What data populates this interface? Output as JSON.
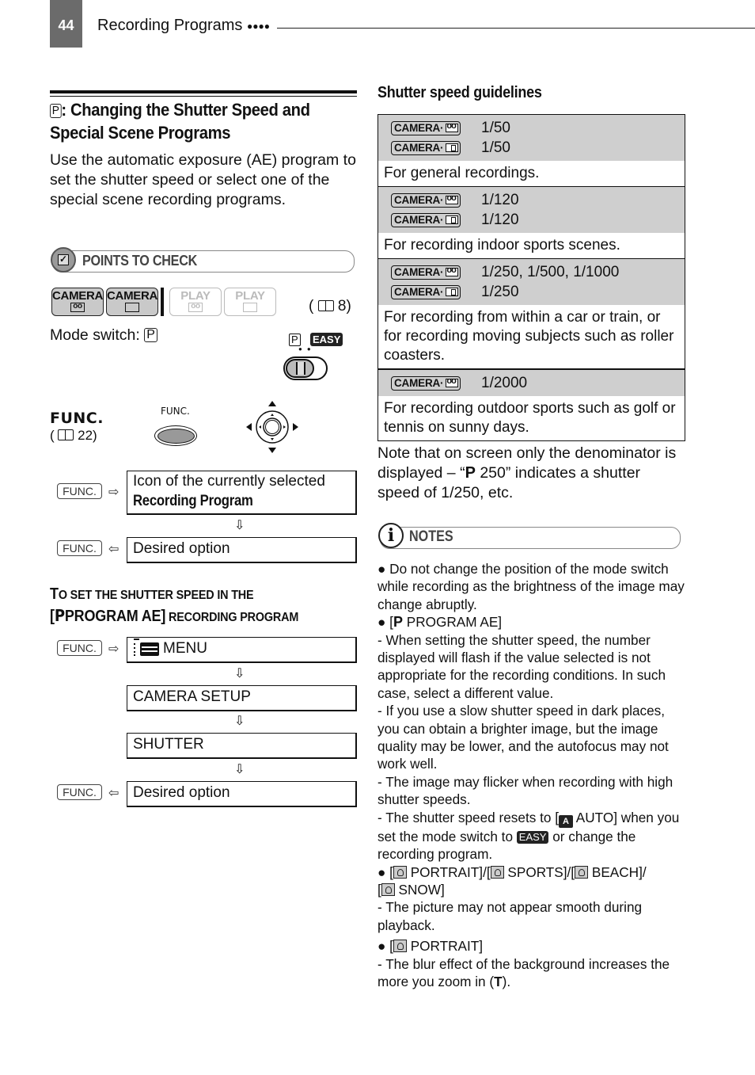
{
  "header": {
    "page_number": "44",
    "running_title": "Recording Programs",
    "dots": "●●●●"
  },
  "left": {
    "title_icon": "P",
    "title_line1": ": Changing the Shutter Speed and",
    "title_line2": "Special Scene Programs",
    "intro": "Use the automatic exposure (AE) program to set the shutter speed or select one of the special scene recording programs.",
    "points_to_check": "POINTS TO CHECK",
    "mode_buttons": [
      {
        "label": "CAMERA",
        "icon": "tape-icon",
        "active": true
      },
      {
        "label": "CAMERA",
        "icon": "card-icon",
        "active": true
      },
      {
        "label": "PLAY",
        "icon": "tape-icon",
        "active": false
      },
      {
        "label": "PLAY",
        "icon": "card-icon",
        "active": false
      }
    ],
    "mode_ref": "8)",
    "mode_ref_open": "(",
    "mode_switch_label": "Mode switch:",
    "mode_switch_value": "P",
    "switch_p": "P",
    "switch_easy": "EASY",
    "func_label": "FUNC.",
    "func_ref": "22)",
    "func_ref_open": "(",
    "func_button_caption": "FUNC.",
    "flow1": {
      "func_key": "FUNC.",
      "step1_line1": "Icon of the currently selected",
      "step1_line2": "Recording Program",
      "step2": "Desired option"
    },
    "subheading": {
      "line1_big": "T",
      "line1_rest": "O SET THE SHUTTER SPEED IN THE",
      "line2_bracket": "[",
      "line2_p": "P",
      "line2_prog": "PROGRAM AE]",
      "line2_rest": " RECORDING PROGRAM"
    },
    "flow2": {
      "func_key": "FUNC.",
      "steps": [
        "MENU",
        "CAMERA SETUP",
        "SHUTTER",
        "Desired option"
      ]
    }
  },
  "right": {
    "heading": "Shutter speed guidelines",
    "rows": [
      {
        "speeds": [
          {
            "badge": "CAMERA·",
            "icon": "tape",
            "value": "1/50"
          },
          {
            "badge": "CAMERA·",
            "icon": "card",
            "value": "1/50"
          }
        ],
        "description": "For general recordings."
      },
      {
        "speeds": [
          {
            "badge": "CAMERA·",
            "icon": "tape",
            "value": "1/120"
          },
          {
            "badge": "CAMERA·",
            "icon": "card",
            "value": "1/120"
          }
        ],
        "description": "For recording indoor sports scenes."
      },
      {
        "speeds": [
          {
            "badge": "CAMERA·",
            "icon": "tape",
            "value": "1/250, 1/500, 1/1000"
          },
          {
            "badge": "CAMERA·",
            "icon": "card",
            "value": "1/250"
          }
        ],
        "description": "For recording from within a car or train, or for recording moving subjects such as roller coasters."
      },
      {
        "speeds": [
          {
            "badge": "CAMERA·",
            "icon": "tape",
            "value": "1/2000"
          }
        ],
        "description": "For recording outdoor sports such as golf or tennis on sunny days."
      }
    ],
    "note_pre": "Note that on screen only the denominator is displayed – “",
    "note_p": "P",
    "note_post": " 250” indicates a shutter speed of 1/250, etc.",
    "notes_label": "NOTES",
    "notes": {
      "b1": "● Do not change the position of the mode switch while recording as the brightness of the image may change abruptly.",
      "b2_pre": "● [",
      "b2_p": "P",
      "b2_post": " PROGRAM AE]",
      "d1": "-  When setting the shutter speed, the number displayed will flash if the value selected is not appropriate for the recording conditions. In such case, select a different value.",
      "d2": "-  If you use a slow shutter speed in dark places, you can obtain a brighter image, but the image quality may be lower, and the autofocus may not work well.",
      "d3": "-  The image may flicker when recording with high shutter speeds.",
      "d4_pre": "-  The shutter speed resets to [",
      "d4_a": "A",
      "d4_mid": " AUTO] when you set the mode switch to ",
      "d4_easy": "EASY",
      "d4_post": " or change the recording program.",
      "b3_pre": "● [",
      "b3_portrait": " PORTRAIT]/[",
      "b3_sports": " SPORTS]/[",
      "b3_beach": " BEACH]/",
      "b3_snow_pre": "[",
      "b3_snow": " SNOW]",
      "d5": "-  The picture may not appear smooth during playback.",
      "b4_pre": "● [",
      "b4_portrait": " PORTRAIT]",
      "d6_pre": "-  The blur effect of the background increases the more you zoom in (",
      "d6_t": "T",
      "d6_post": ")."
    }
  }
}
